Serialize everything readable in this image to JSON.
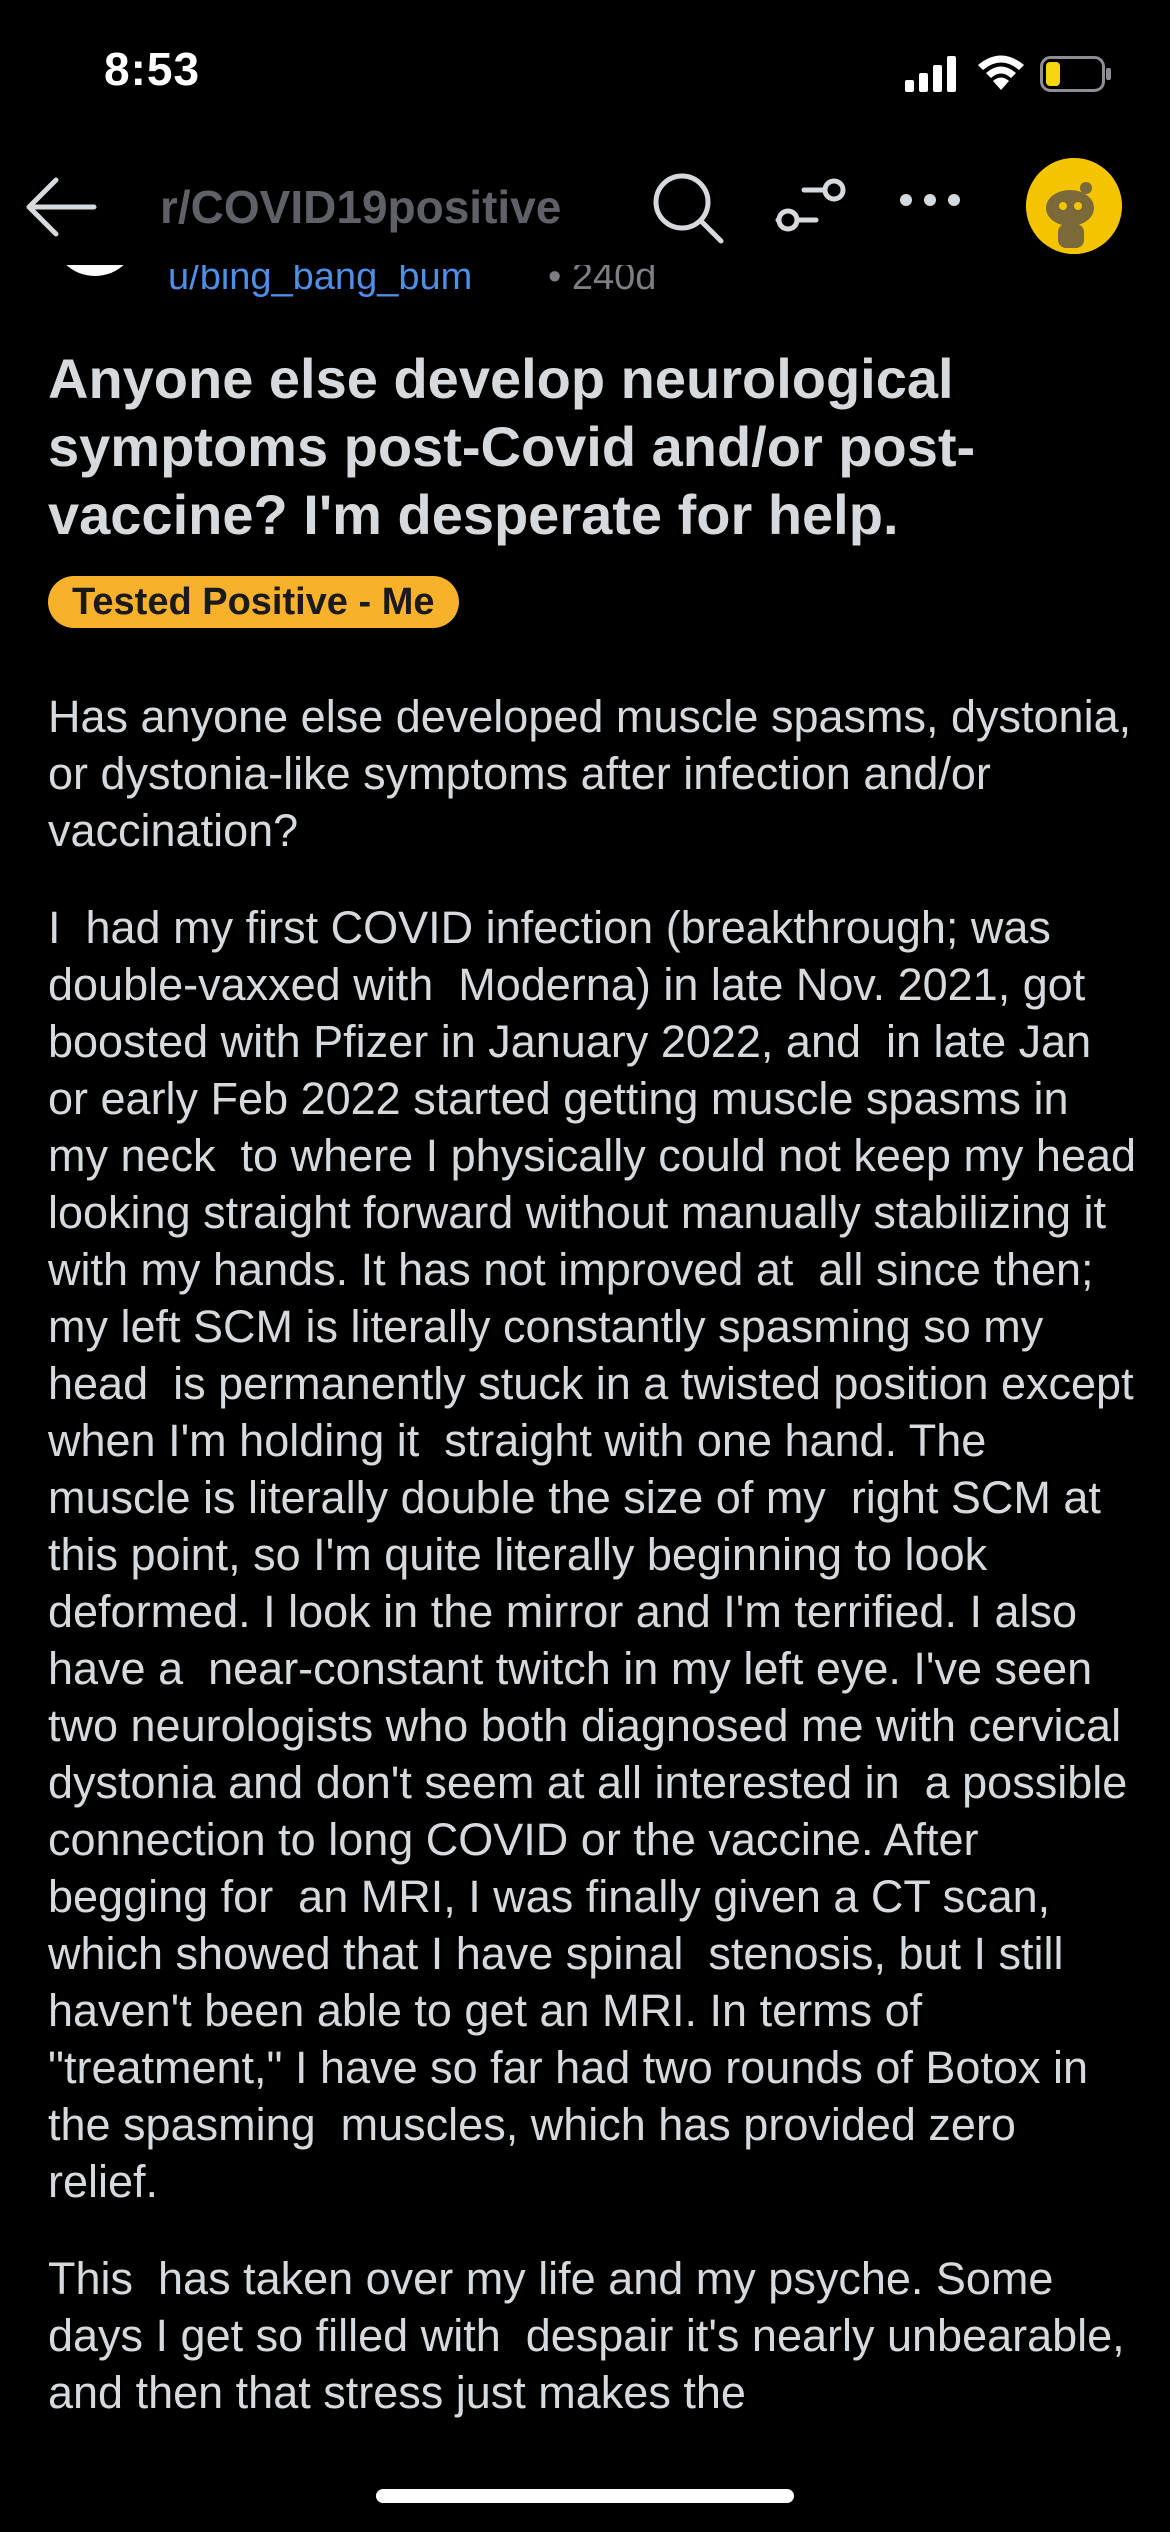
{
  "status_bar": {
    "time": "8:53",
    "icons": [
      "signal-icon",
      "wifi-icon",
      "battery-icon"
    ],
    "battery_color": "#f5d410"
  },
  "nav": {
    "title": "r/COVID19positive",
    "icons": [
      "back-icon",
      "search-icon",
      "filter-icon",
      "more-icon",
      "avatar"
    ],
    "avatar_color": "#f5c400"
  },
  "post": {
    "author": "u/bing_bang_bum",
    "age": "240d",
    "separator": "•",
    "title": "Anyone else develop neurological symptoms post-Covid and/or post-vaccine? I'm desperate for help.",
    "flair": "Tested Positive - Me",
    "flair_color": "#f7b12b",
    "author_color": "#4f8fe6",
    "paragraphs": [
      "Has anyone else developed muscle spasms, dystonia, or dystonia-like symptoms after infection and/or vaccination?",
      "I  had my first COVID infection (breakthrough; was double-vaxxed with  Moderna) in late Nov. 2021, got boosted with Pfizer in January 2022, and  in late Jan or early Feb 2022 started getting muscle spasms in my neck  to where I physically could not keep my head looking straight forward without manually stabilizing it with my hands. It has not improved at  all since then; my left SCM is literally constantly spasming so my head  is permanently stuck in a twisted position except when I'm holding it  straight with one hand. The muscle is literally double the size of my  right SCM at this point, so I'm quite literally beginning to look  deformed. I look in the mirror and I'm terrified. I also have a  near-constant twitch in my left eye. I've seen two neurologists who both diagnosed me with cervical dystonia and don't seem at all interested in  a possible connection to long COVID or the vaccine. After begging for  an MRI, I was finally given a CT scan, which showed that I have spinal  stenosis, but I still haven't been able to get an MRI. In terms of  \"treatment,\" I have so far had two rounds of Botox in the spasming  muscles, which has provided zero relief.",
      "This  has taken over my life and my psyche. Some days I get so filled with  despair it's nearly unbearable, and then that stress just makes the"
    ]
  }
}
